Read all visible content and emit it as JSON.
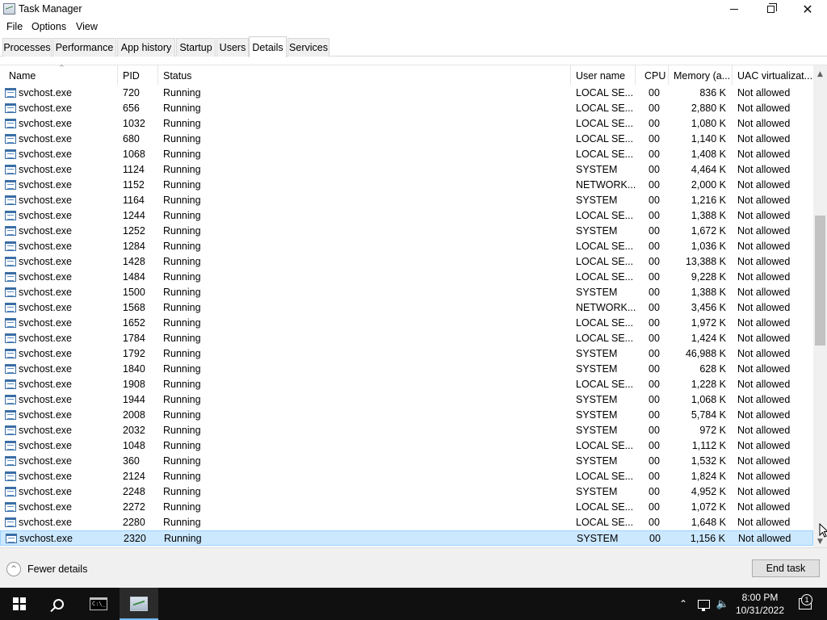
{
  "window": {
    "title": "Task Manager",
    "minimize_icon": "minimize-icon",
    "maximize_icon": "restore-icon",
    "close_icon": "close-icon"
  },
  "menu": [
    "File",
    "Options",
    "View"
  ],
  "tabs": [
    {
      "label": "Processes",
      "active": false
    },
    {
      "label": "Performance",
      "active": false
    },
    {
      "label": "App history",
      "active": false
    },
    {
      "label": "Startup",
      "active": false
    },
    {
      "label": "Users",
      "active": false
    },
    {
      "label": "Details",
      "active": true
    },
    {
      "label": "Services",
      "active": false
    }
  ],
  "table": {
    "columns": [
      "Name",
      "PID",
      "Status",
      "User name",
      "CPU",
      "Memory (a...",
      "UAC virtualizat..."
    ],
    "rows": [
      [
        "svchost.exe",
        "720",
        "Running",
        "LOCAL SE...",
        "00",
        "836 K",
        "Not allowed"
      ],
      [
        "svchost.exe",
        "656",
        "Running",
        "LOCAL SE...",
        "00",
        "2,880 K",
        "Not allowed"
      ],
      [
        "svchost.exe",
        "1032",
        "Running",
        "LOCAL SE...",
        "00",
        "1,080 K",
        "Not allowed"
      ],
      [
        "svchost.exe",
        "680",
        "Running",
        "LOCAL SE...",
        "00",
        "1,140 K",
        "Not allowed"
      ],
      [
        "svchost.exe",
        "1068",
        "Running",
        "LOCAL SE...",
        "00",
        "1,408 K",
        "Not allowed"
      ],
      [
        "svchost.exe",
        "1124",
        "Running",
        "SYSTEM",
        "00",
        "4,464 K",
        "Not allowed"
      ],
      [
        "svchost.exe",
        "1152",
        "Running",
        "NETWORK...",
        "00",
        "2,000 K",
        "Not allowed"
      ],
      [
        "svchost.exe",
        "1164",
        "Running",
        "SYSTEM",
        "00",
        "1,216 K",
        "Not allowed"
      ],
      [
        "svchost.exe",
        "1244",
        "Running",
        "LOCAL SE...",
        "00",
        "1,388 K",
        "Not allowed"
      ],
      [
        "svchost.exe",
        "1252",
        "Running",
        "SYSTEM",
        "00",
        "1,672 K",
        "Not allowed"
      ],
      [
        "svchost.exe",
        "1284",
        "Running",
        "LOCAL SE...",
        "00",
        "1,036 K",
        "Not allowed"
      ],
      [
        "svchost.exe",
        "1428",
        "Running",
        "LOCAL SE...",
        "00",
        "13,388 K",
        "Not allowed"
      ],
      [
        "svchost.exe",
        "1484",
        "Running",
        "LOCAL SE...",
        "00",
        "9,228 K",
        "Not allowed"
      ],
      [
        "svchost.exe",
        "1500",
        "Running",
        "SYSTEM",
        "00",
        "1,388 K",
        "Not allowed"
      ],
      [
        "svchost.exe",
        "1568",
        "Running",
        "NETWORK...",
        "00",
        "3,456 K",
        "Not allowed"
      ],
      [
        "svchost.exe",
        "1652",
        "Running",
        "LOCAL SE...",
        "00",
        "1,972 K",
        "Not allowed"
      ],
      [
        "svchost.exe",
        "1784",
        "Running",
        "LOCAL SE...",
        "00",
        "1,424 K",
        "Not allowed"
      ],
      [
        "svchost.exe",
        "1792",
        "Running",
        "SYSTEM",
        "00",
        "46,988 K",
        "Not allowed"
      ],
      [
        "svchost.exe",
        "1840",
        "Running",
        "SYSTEM",
        "00",
        "628 K",
        "Not allowed"
      ],
      [
        "svchost.exe",
        "1908",
        "Running",
        "LOCAL SE...",
        "00",
        "1,228 K",
        "Not allowed"
      ],
      [
        "svchost.exe",
        "1944",
        "Running",
        "SYSTEM",
        "00",
        "1,068 K",
        "Not allowed"
      ],
      [
        "svchost.exe",
        "2008",
        "Running",
        "SYSTEM",
        "00",
        "5,784 K",
        "Not allowed"
      ],
      [
        "svchost.exe",
        "2032",
        "Running",
        "SYSTEM",
        "00",
        "972 K",
        "Not allowed"
      ],
      [
        "svchost.exe",
        "1048",
        "Running",
        "LOCAL SE...",
        "00",
        "1,112 K",
        "Not allowed"
      ],
      [
        "svchost.exe",
        "360",
        "Running",
        "SYSTEM",
        "00",
        "1,532 K",
        "Not allowed"
      ],
      [
        "svchost.exe",
        "2124",
        "Running",
        "LOCAL SE...",
        "00",
        "1,824 K",
        "Not allowed"
      ],
      [
        "svchost.exe",
        "2248",
        "Running",
        "SYSTEM",
        "00",
        "4,952 K",
        "Not allowed"
      ],
      [
        "svchost.exe",
        "2272",
        "Running",
        "LOCAL SE...",
        "00",
        "1,072 K",
        "Not allowed"
      ],
      [
        "svchost.exe",
        "2280",
        "Running",
        "LOCAL SE...",
        "00",
        "1,648 K",
        "Not allowed"
      ],
      [
        "svchost.exe",
        "2320",
        "Running",
        "SYSTEM",
        "00",
        "1,156 K",
        "Not allowed"
      ]
    ],
    "selected_row_index": 29,
    "row_icon": "exe-icon"
  },
  "footer": {
    "fewer_details": "Fewer details",
    "end_task": "End task"
  },
  "taskbar": {
    "time": "8:00 PM",
    "date": "10/31/2022",
    "notification_count": "1",
    "apps": [
      "command-prompt-icon",
      "task-manager-icon"
    ]
  },
  "colors": {
    "selection_bg": "#cce8ff",
    "selection_border": "#99d1ff",
    "taskbar_bg": "#101010",
    "active_tab_bg": "#ffffff"
  }
}
